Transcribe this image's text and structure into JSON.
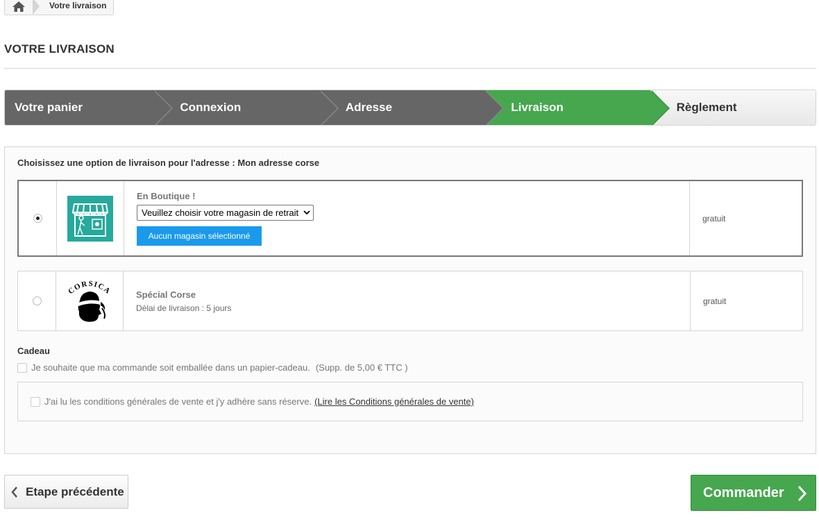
{
  "breadcrumb": {
    "home_icon": "home-icon",
    "current": "Votre livraison"
  },
  "page_title": "VOTRE LIVRAISON",
  "steps": [
    {
      "label": "Votre panier",
      "state": "done"
    },
    {
      "label": "Connexion",
      "state": "done"
    },
    {
      "label": "Adresse",
      "state": "done"
    },
    {
      "label": "Livraison",
      "state": "active"
    },
    {
      "label": "Règlement",
      "state": "todo"
    }
  ],
  "delivery": {
    "title": "Choisissez une option de livraison pour l'adresse : Mon adresse corse",
    "options": [
      {
        "selected": true,
        "logo": "store-icon",
        "name": "En Boutique !",
        "select_value": "Veuillez choisir votre magasin de retrait",
        "button": "Aucun magasin sélectionné",
        "price": "gratuit"
      },
      {
        "selected": false,
        "logo": "corsica-flag-icon",
        "logo_text": "CORSICA",
        "name": "Spécial Corse",
        "delay": "Délai de livraison : 5 jours",
        "price": "gratuit"
      }
    ],
    "gift_title": "Cadeau",
    "gift_label": "Je souhaite que ma commande soit emballée dans un papier-cadeau.",
    "gift_supp": "(Supp. de 5,00 € TTC )",
    "cgv_label": "J'ai lu les conditions générales de vente et j'y adhère sans réserve.",
    "cgv_link": "(Lire les Conditions générales de vente)"
  },
  "buttons": {
    "prev": "Etape précédente",
    "order": "Commander"
  },
  "colors": {
    "active_step": "#46a74e",
    "done_step": "#666666",
    "store_button": "#1a9aec",
    "store_logo_bg": "#27a99c"
  }
}
